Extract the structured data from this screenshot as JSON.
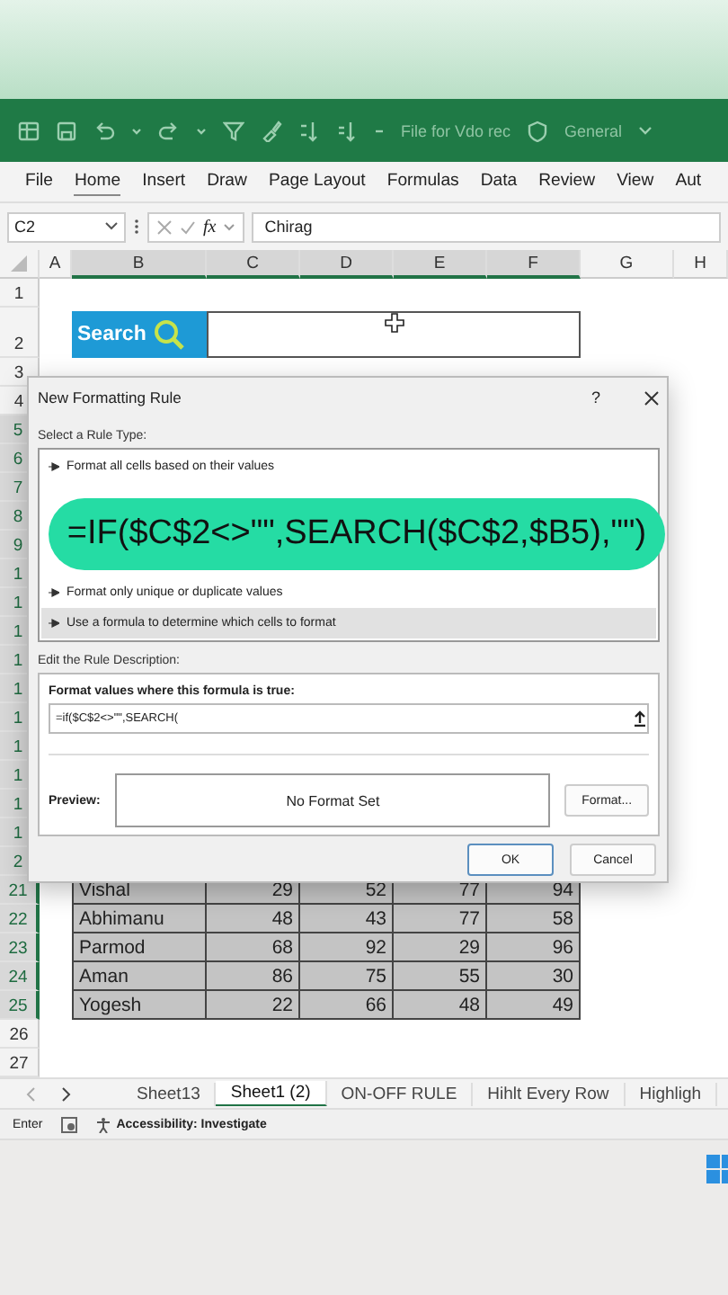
{
  "title_bar": {
    "file_name": "File for Vdo rec",
    "sensitivity": "General"
  },
  "ribbon_tabs": [
    {
      "label": "File",
      "selected": false
    },
    {
      "label": "Home",
      "selected": true
    },
    {
      "label": "Insert",
      "selected": false
    },
    {
      "label": "Draw",
      "selected": false
    },
    {
      "label": "Page Layout",
      "selected": false
    },
    {
      "label": "Formulas",
      "selected": false
    },
    {
      "label": "Data",
      "selected": false
    },
    {
      "label": "Review",
      "selected": false
    },
    {
      "label": "View",
      "selected": false
    },
    {
      "label": "Aut",
      "selected": false
    }
  ],
  "formula_bar": {
    "name_box": "C2",
    "function_label": "fx",
    "value": "Chirag"
  },
  "columns": [
    {
      "label": "A",
      "selected": false
    },
    {
      "label": "B",
      "selected": true
    },
    {
      "label": "C",
      "selected": true
    },
    {
      "label": "D",
      "selected": true
    },
    {
      "label": "E",
      "selected": true
    },
    {
      "label": "F",
      "selected": true
    },
    {
      "label": "G",
      "selected": false
    },
    {
      "label": "H",
      "selected": false
    }
  ],
  "rows": [
    {
      "number": "1",
      "selected": false,
      "kind": "blank"
    },
    {
      "number": "2",
      "selected": false,
      "kind": "search",
      "label": "Search"
    },
    {
      "number": "3",
      "selected": false,
      "kind": "blank"
    },
    {
      "number": "4",
      "selected": false,
      "kind": "blank"
    },
    {
      "number": "5",
      "selected": true,
      "kind": "blank"
    },
    {
      "number": "6",
      "selected": true,
      "kind": "blank"
    },
    {
      "number": "7",
      "selected": true,
      "kind": "blank"
    },
    {
      "number": "8",
      "selected": true,
      "kind": "blank"
    },
    {
      "number": "9",
      "selected": true,
      "kind": "blank"
    },
    {
      "number": "1",
      "selected": true,
      "kind": "blank"
    },
    {
      "number": "1",
      "selected": true,
      "kind": "blank"
    },
    {
      "number": "1",
      "selected": true,
      "kind": "blank"
    },
    {
      "number": "1",
      "selected": true,
      "kind": "blank"
    },
    {
      "number": "1",
      "selected": true,
      "kind": "blank"
    },
    {
      "number": "1",
      "selected": true,
      "kind": "blank"
    },
    {
      "number": "1",
      "selected": true,
      "kind": "blank"
    },
    {
      "number": "1",
      "selected": true,
      "kind": "blank"
    },
    {
      "number": "1",
      "selected": true,
      "kind": "blank"
    },
    {
      "number": "1",
      "selected": true,
      "kind": "blank"
    },
    {
      "number": "2",
      "selected": true,
      "kind": "blank"
    },
    {
      "number": "21",
      "selected": true,
      "kind": "data",
      "cells": [
        "Vishal",
        "29",
        "52",
        "77",
        "94"
      ]
    },
    {
      "number": "22",
      "selected": true,
      "kind": "data",
      "cells": [
        "Abhimanu",
        "48",
        "43",
        "77",
        "58"
      ]
    },
    {
      "number": "23",
      "selected": true,
      "kind": "data",
      "cells": [
        "Parmod",
        "68",
        "92",
        "29",
        "96"
      ]
    },
    {
      "number": "24",
      "selected": true,
      "kind": "data",
      "cells": [
        "Aman",
        "86",
        "75",
        "55",
        "30"
      ]
    },
    {
      "number": "25",
      "selected": true,
      "kind": "data",
      "cells": [
        "Yogesh",
        "22",
        "66",
        "48",
        "49"
      ]
    },
    {
      "number": "26",
      "selected": false,
      "kind": "blank"
    },
    {
      "number": "27",
      "selected": false,
      "kind": "blank"
    }
  ],
  "dialog": {
    "title": "New Formatting Rule",
    "help": "?",
    "rule_type_label": "Select a Rule Type:",
    "rule_types": [
      {
        "label": "Format all cells based on their values",
        "selected": false
      },
      {
        "label": "Format only unique or duplicate values",
        "selected": false
      },
      {
        "label": "Use a formula to determine which cells to format",
        "selected": true
      }
    ],
    "description_label": "Edit the Rule Description:",
    "formula_label": "Format values where this formula is true:",
    "formula_value": "=if($C$2<>\"\",SEARCH(",
    "preview_label": "Preview:",
    "preview_text": "No Format Set",
    "format_button": "Format...",
    "ok": "OK",
    "cancel": "Cancel"
  },
  "formula_overlay": "=IF($C$2<>\"\",SEARCH($C$2,$B5),\"\")",
  "sheet_tabs": [
    {
      "label": "Sheet13",
      "selected": false
    },
    {
      "label": "Sheet1 (2)",
      "selected": true
    },
    {
      "label": "ON-OFF RULE",
      "selected": false
    },
    {
      "label": "Hihlt Every Row",
      "selected": false
    },
    {
      "label": "Highligh",
      "selected": false
    }
  ],
  "status_bar": {
    "mode": "Enter",
    "accessibility": "Accessibility: Investigate"
  }
}
